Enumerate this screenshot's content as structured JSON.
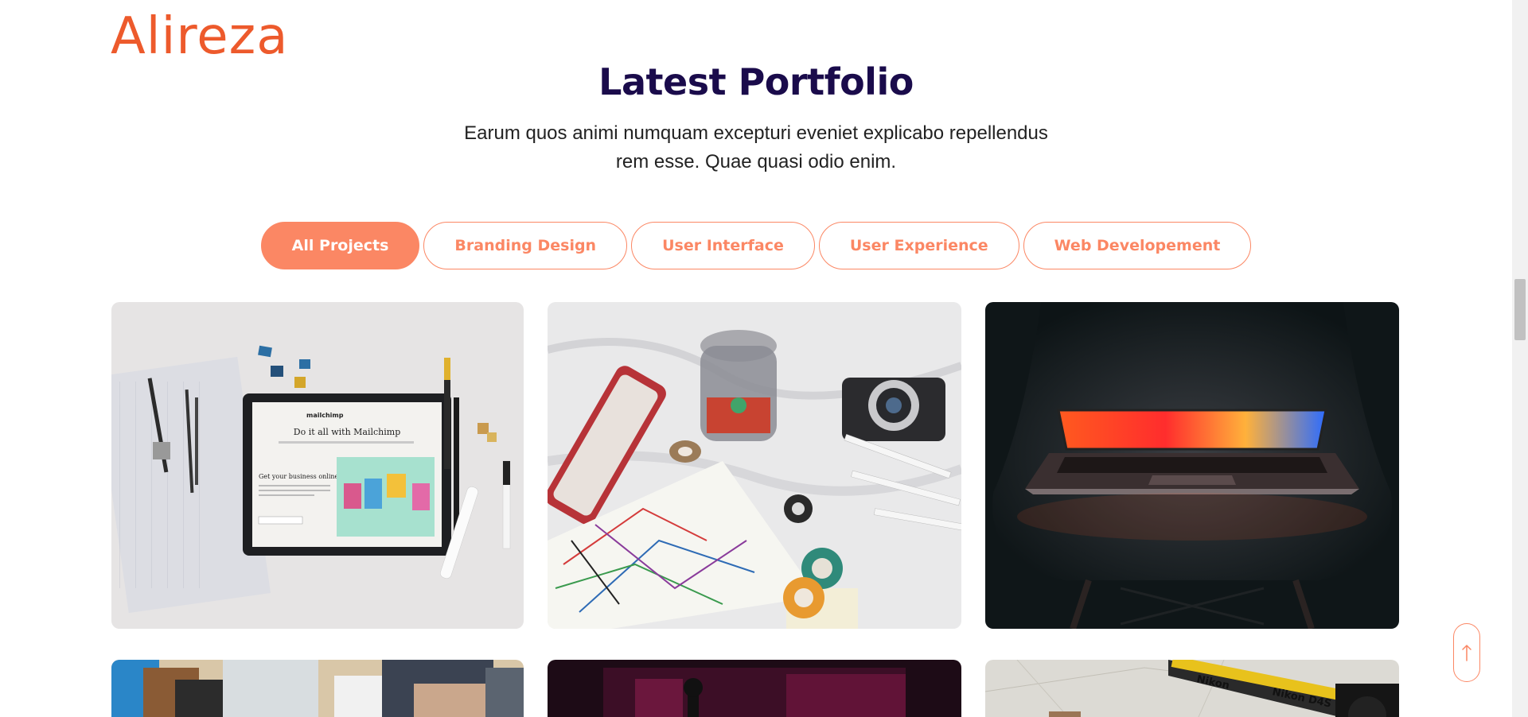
{
  "logo": {
    "text": "Alireza"
  },
  "section": {
    "title": "Latest Portfolio",
    "subtitle": "Earum quos animi numquam excepturi eveniet explicabo repellendus rem esse. Quae quasi odio enim."
  },
  "filters": [
    {
      "label": "All Projects",
      "active": true
    },
    {
      "label": "Branding Design",
      "active": false
    },
    {
      "label": "User Interface",
      "active": false
    },
    {
      "label": "User Experience",
      "active": false
    },
    {
      "label": "Web Developement",
      "active": false
    }
  ],
  "portfolio": [
    {
      "image": "tablet-mailchimp-photo",
      "text": {
        "brand": "mailchimp",
        "headline": "Do it all with Mailchimp",
        "subhead": "Get your business online"
      }
    },
    {
      "image": "camera-tape-map-photo"
    },
    {
      "image": "laptop-on-chair-photo"
    },
    {
      "image": "desk-laptop-photo"
    },
    {
      "image": "dark-controller-photo"
    },
    {
      "image": "camera-map-photo",
      "text": {
        "strap_left": "Nikon",
        "strap_right": "Nikon D4S"
      }
    }
  ],
  "icons": {
    "scroll_top": "arrow-up-icon"
  },
  "colors": {
    "accent": "#fb8764",
    "logo": "#ed5a2c",
    "title": "#1a0b4b"
  }
}
